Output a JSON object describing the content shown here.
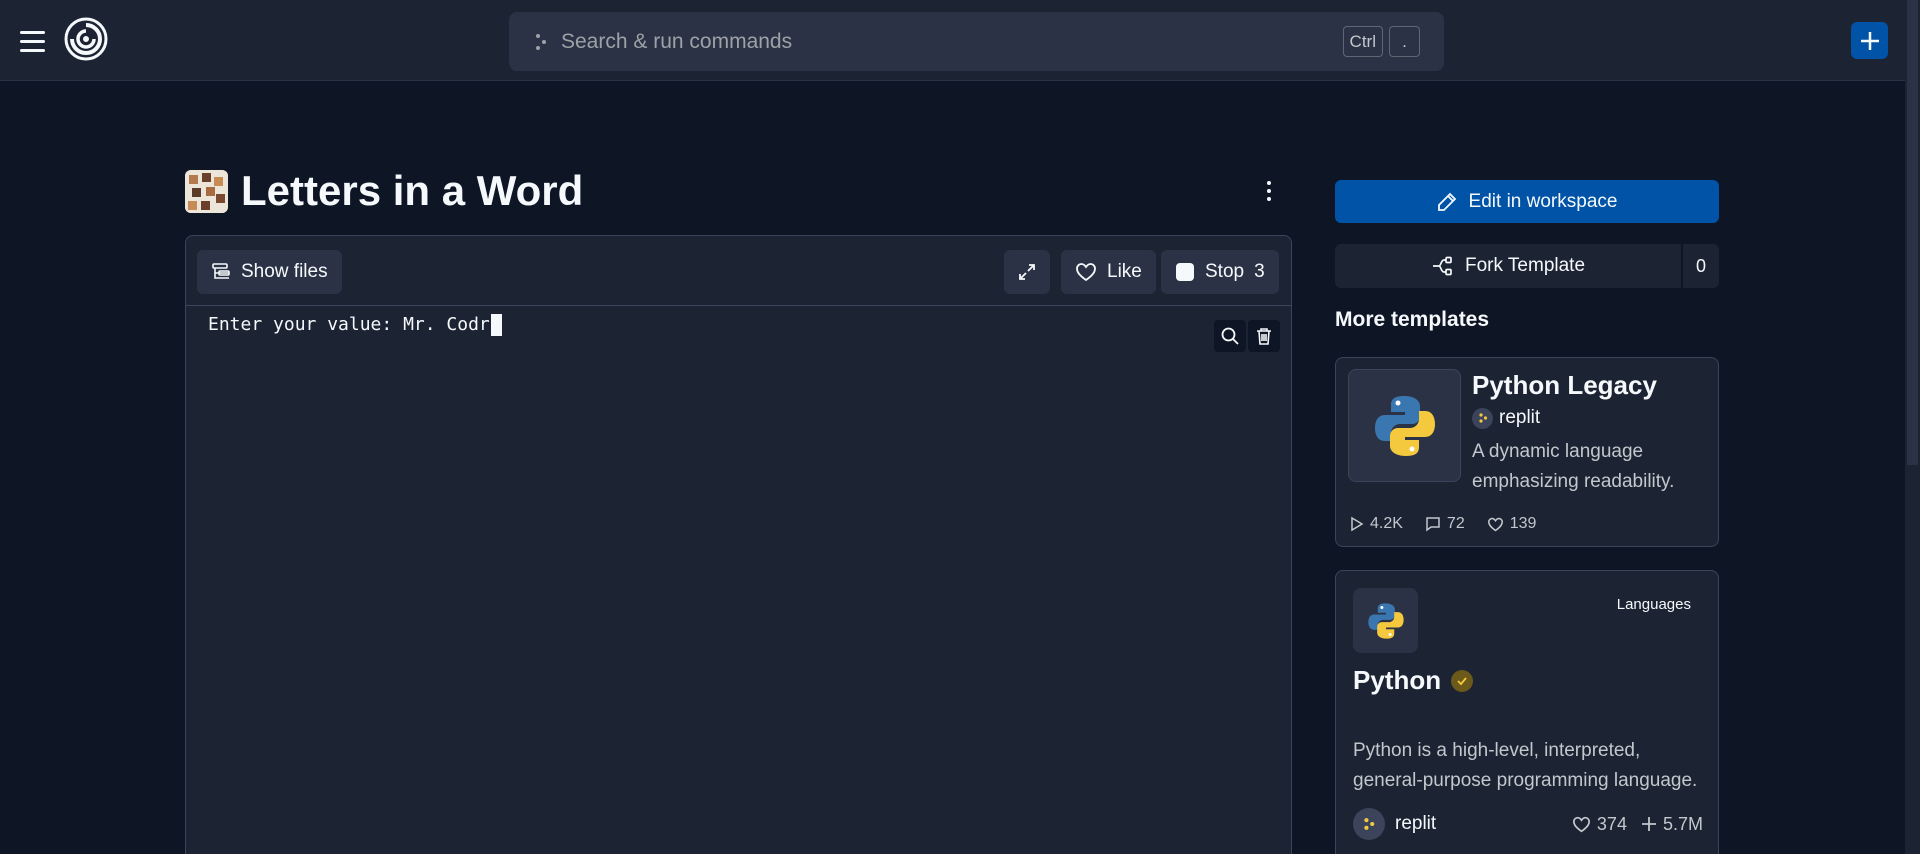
{
  "header": {
    "search_placeholder": "Search & run commands",
    "shortcut_key1": "Ctrl",
    "shortcut_key2": "."
  },
  "page": {
    "title": "Letters in a Word"
  },
  "console": {
    "show_files_label": "Show files",
    "like_label": "Like",
    "stop_label": "Stop",
    "stop_count": "3",
    "output_text": "Enter your value: Mr. Codr"
  },
  "sidebar": {
    "edit_label": "Edit in workspace",
    "fork_label": "Fork Template",
    "fork_count": "0",
    "more_templates_title": "More templates"
  },
  "templates": [
    {
      "title": "Python Legacy",
      "author": "replit",
      "description": "A dynamic language emphasizing readability.",
      "runs": "4.2K",
      "comments": "72",
      "likes": "139"
    },
    {
      "title": "Python",
      "badge": "Languages",
      "description": "Python is a high-level, interpreted, general-purpose programming language.",
      "author": "replit",
      "likes": "374",
      "forks": "5.7M"
    }
  ],
  "colors": {
    "background": "#0e1525",
    "surface": "#1c2333",
    "accent": "#0053a6",
    "border": "#3c445c"
  }
}
